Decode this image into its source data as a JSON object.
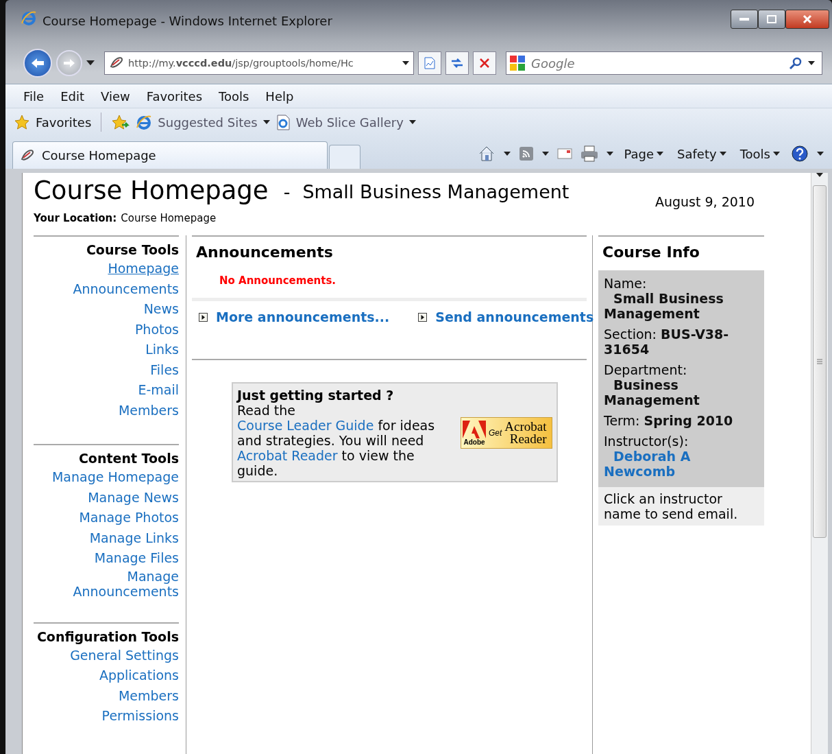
{
  "window": {
    "title": "Course Homepage - Windows Internet Explorer"
  },
  "address": {
    "url": "http://my.**vcccd.edu**/jsp/grouptools/home/Hc"
  },
  "search": {
    "placeholder": "Google"
  },
  "menu": [
    "File",
    "Edit",
    "View",
    "Favorites",
    "Tools",
    "Help"
  ],
  "favorites": {
    "label": "Favorites",
    "links": [
      {
        "label": "Suggested Sites",
        "kind": "ie"
      },
      {
        "label": "Web Slice Gallery",
        "kind": "page"
      }
    ]
  },
  "tab": {
    "label": "Course Homepage"
  },
  "commands": [
    "Page",
    "Safety",
    "Tools"
  ],
  "page": {
    "title": "Course Homepage",
    "separator": "-",
    "subtitle": "Small Business Management",
    "date": "August 9, 2010",
    "location_label": "Your Location:",
    "location": "Course Homepage"
  },
  "sidebar": [
    {
      "title": "Course Tools",
      "items": [
        {
          "label": "Homepage",
          "selected": true
        },
        {
          "label": "Announcements",
          "selected": false
        },
        {
          "label": "News",
          "selected": false
        },
        {
          "label": "Photos",
          "selected": false
        },
        {
          "label": "Links",
          "selected": false
        },
        {
          "label": "Files",
          "selected": false
        },
        {
          "label": "E-mail",
          "selected": false
        },
        {
          "label": "Members",
          "selected": false
        }
      ]
    },
    {
      "title": "Content Tools",
      "items": [
        {
          "label": "Manage Homepage",
          "selected": false
        },
        {
          "label": "Manage News",
          "selected": false
        },
        {
          "label": "Manage Photos",
          "selected": false
        },
        {
          "label": "Manage Links",
          "selected": false
        },
        {
          "label": "Manage Files",
          "selected": false
        },
        {
          "label": "Manage Announcements",
          "selected": false
        }
      ]
    },
    {
      "title": "Configuration Tools",
      "items": [
        {
          "label": "General Settings",
          "selected": false
        },
        {
          "label": "Applications",
          "selected": false
        },
        {
          "label": "Members",
          "selected": false
        },
        {
          "label": "Permissions",
          "selected": false
        }
      ]
    }
  ],
  "announcements": {
    "title": "Announcements",
    "empty": "No Announcements.",
    "links": [
      "More announcements...",
      "Send announcements"
    ]
  },
  "getting_started": {
    "title": "Just getting started ?",
    "body": [
      {
        "kind": "text",
        "text": "Read the "
      },
      {
        "kind": "link",
        "text": "Course Leader Guide"
      },
      {
        "kind": "text",
        "text": " for ideas and strategies. You will need "
      },
      {
        "kind": "link",
        "text": "Acrobat Reader"
      },
      {
        "kind": "text",
        "text": " to view the guide."
      }
    ],
    "badge": {
      "brand": "Adobe",
      "prefix": "Get",
      "product": "Acrobat",
      "product2": "Reader"
    }
  },
  "course_info": {
    "title": "Course Info",
    "fields": [
      {
        "label": "Name:",
        "value": "Small Business Management",
        "kind": "block"
      },
      {
        "label": "Section:",
        "value": "BUS-V38-31654",
        "kind": "inline"
      },
      {
        "label": "Department:",
        "value": "Business Management",
        "kind": "block"
      },
      {
        "label": "Term:",
        "value": "Spring 2010",
        "kind": "inline"
      },
      {
        "label": "Instructor(s):",
        "value": "Deborah A Newcomb",
        "kind": "link"
      }
    ],
    "note": "Click an instructor name to send email."
  }
}
